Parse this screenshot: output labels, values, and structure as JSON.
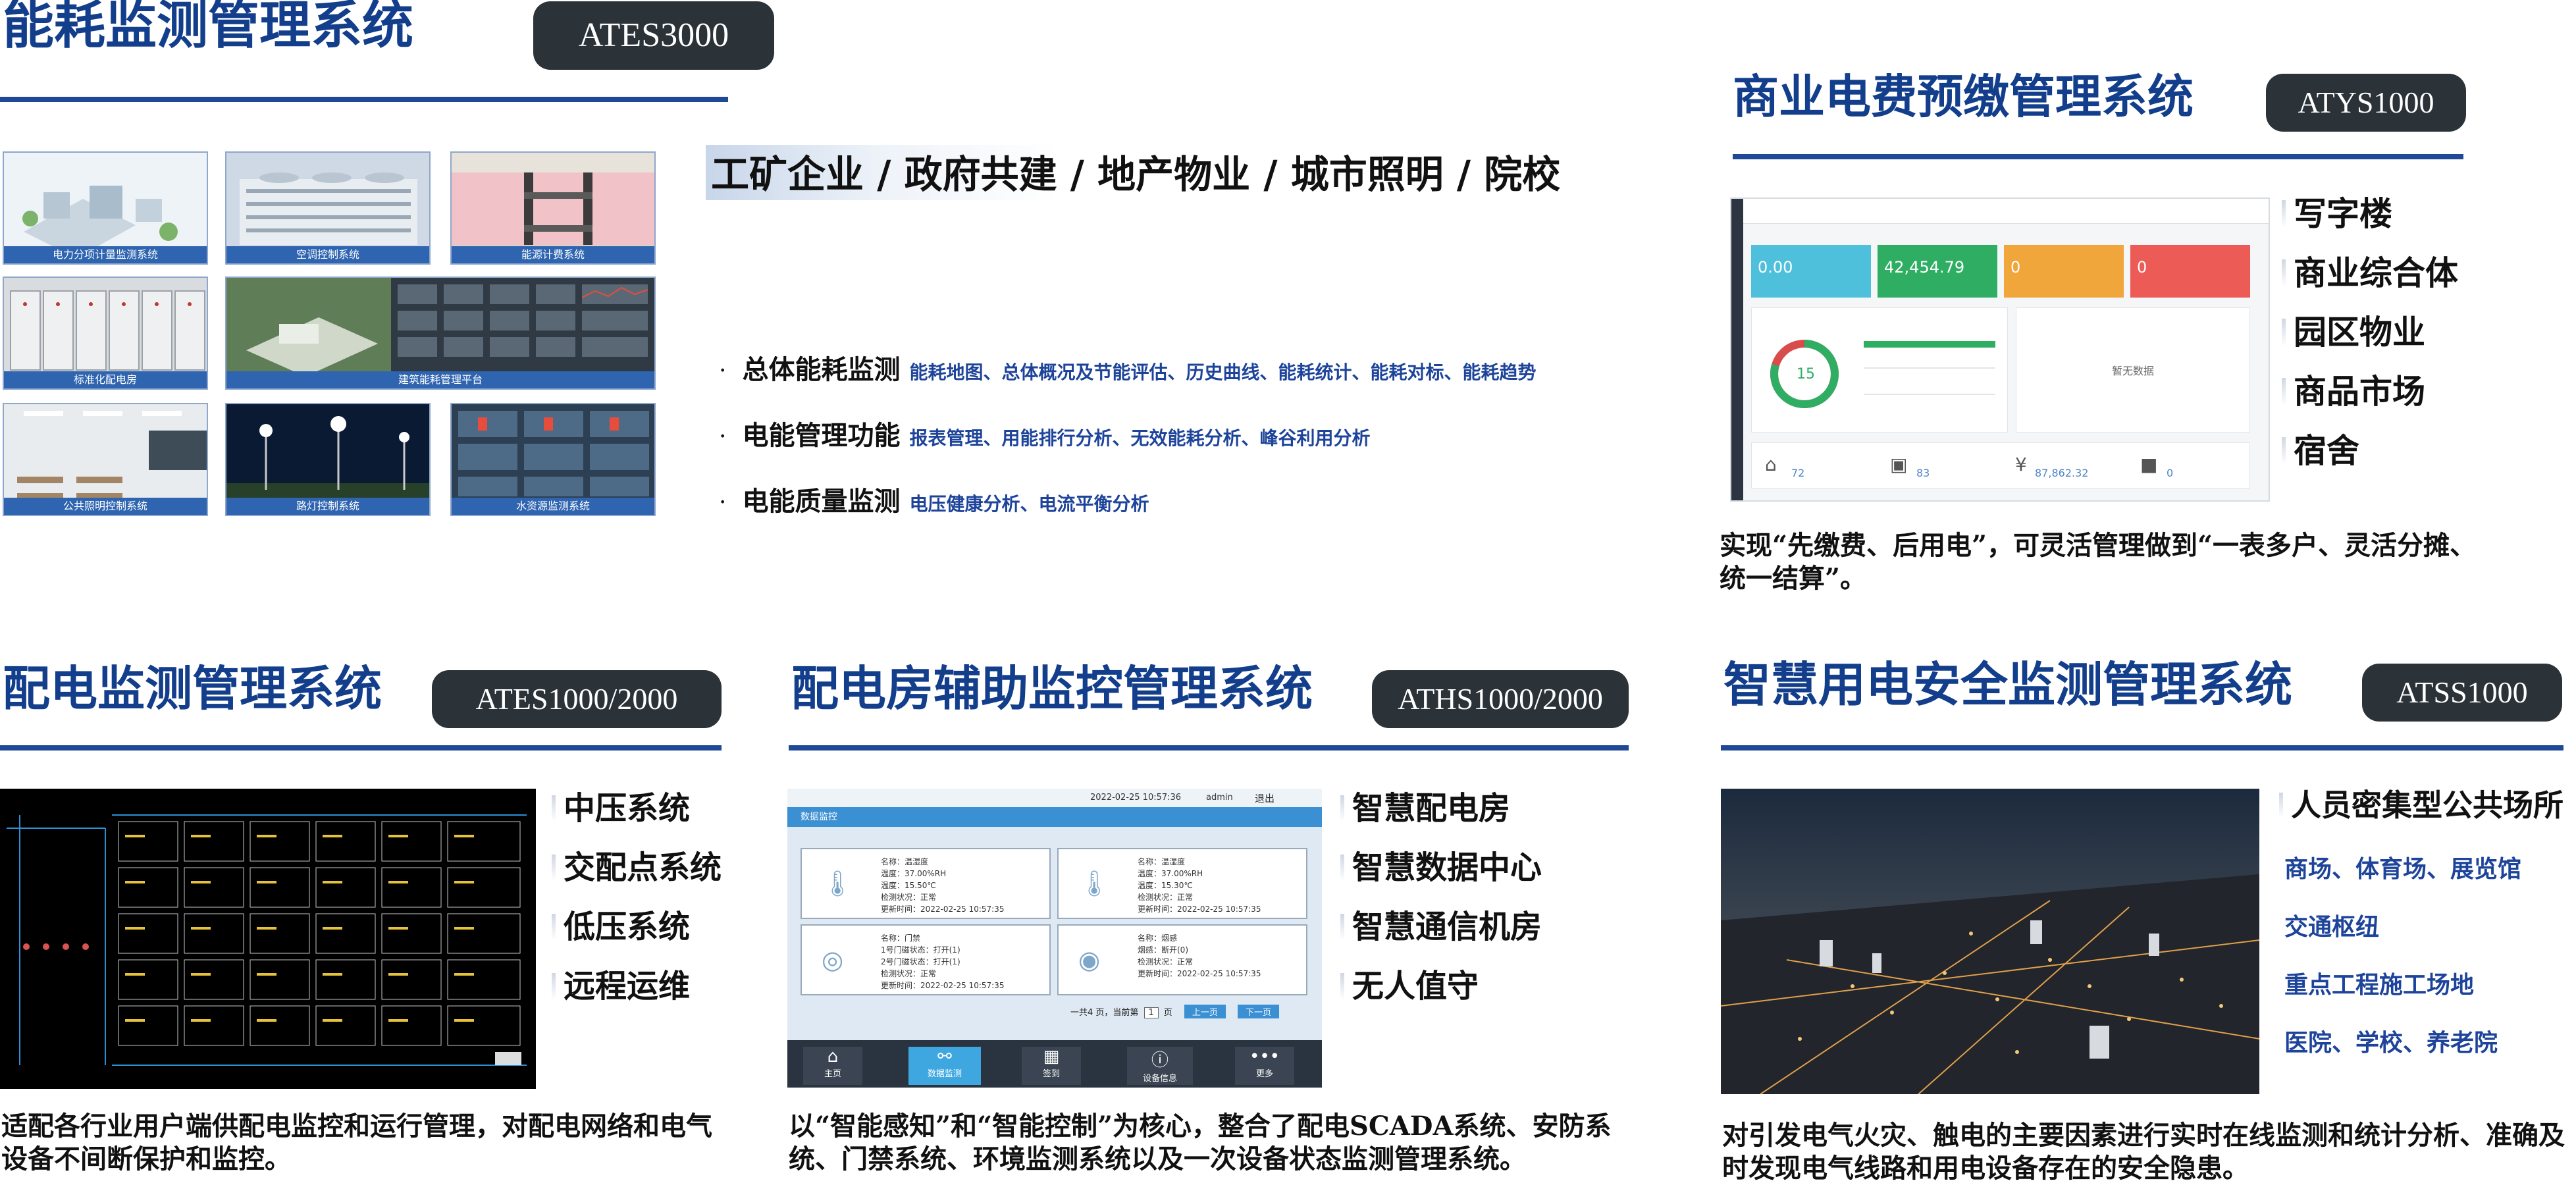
{
  "colors": {
    "title_blue": "#133e8c",
    "badge_dark": "#2b3238",
    "rule_blue": "#1f4896",
    "accent_blue": "#1d449a"
  },
  "ates3000": {
    "title": "能耗监测管理系统",
    "badge": "ATES3000",
    "industries": "工矿企业 / 政府共建 / 地产物业 / 城市照明 / 院校",
    "thumbs": [
      "电力分项计量监测系统",
      "空调控制系统",
      "能源计费系统",
      "标准化配电房",
      "建筑能耗管理平台",
      "",
      "公共照明控制系统",
      "路灯控制系统",
      "水资源监测系统"
    ],
    "features": [
      {
        "key": "总体能耗监测",
        "value": "能耗地图、总体概况及节能评估、历史曲线、能耗统计、能耗对标、能耗趋势"
      },
      {
        "key": "电能管理功能",
        "value": "报表管理、用能排行分析、无效能耗分析、峰谷利用分析"
      },
      {
        "key": "电能质量监测",
        "value": "电压健康分析、电流平衡分析"
      }
    ]
  },
  "atys1000": {
    "title": "商业电费预缴管理系统",
    "badge": "ATYS1000",
    "items": [
      "写字楼",
      "商业综合体",
      "园区物业",
      "商品市场",
      "宿舍"
    ],
    "desc": "实现“先缴费、后用电”，可灵活管理做到“一表多户、灵活分摊、统一结算”。",
    "screen": {
      "cards": [
        "0.00",
        "42,454.79",
        "0",
        "0"
      ],
      "gauge": "15",
      "empty": "暂无数据",
      "stats": [
        "72",
        "83",
        "87,862.32",
        "0"
      ]
    }
  },
  "ates1000": {
    "title": "配电监测管理系统",
    "badge": "ATES1000/2000",
    "items": [
      "中压系统",
      "交配点系统",
      "低压系统",
      "远程运维"
    ],
    "desc": "适配各行业用户端供配电监控和运行管理，对配电网络和电气设备不间断保护和监控。"
  },
  "aths1000": {
    "title": "配电房辅助监控管理系统",
    "badge": "ATHS1000/2000",
    "items": [
      "智慧配电房",
      "智慧数据中心",
      "智慧通信机房",
      "无人值守"
    ],
    "desc": "以“智能感知”和“智能控制”为核心，整合了配电SCADA系统、安防系统、门禁系统、环境监测系统以及一次设备状态监测管理系统。",
    "screen": {
      "time": "2022-02-25 10:57:36",
      "user": "admin",
      "logout": "退出",
      "header": "数据监控",
      "panels": [
        [
          "名称：温湿度",
          "温度：37.00%RH",
          "温度：15.50℃",
          "检测状况：正常",
          "更新时间：2022-02-25 10:57:35"
        ],
        [
          "名称：温湿度",
          "温度：37.00%RH",
          "温度：15.30℃",
          "检测状况：正常",
          "更新时间：2022-02-25 10:57:35"
        ],
        [
          "名称：门禁",
          "1号门磁状态：打开(1)",
          "2号门磁状态：打开(1)",
          "检测状况：正常",
          "更新时间：2022-02-25 10:57:35"
        ],
        [
          "名称：烟感",
          "烟感：断开(0)",
          "检测状况：正常",
          "更新时间：2022-02-25 10:57:35"
        ]
      ],
      "pager": "一共4 页，当前第",
      "page": "1",
      "page_unit": "页",
      "prev": "上一页",
      "next": "下一页",
      "nav": [
        "主页",
        "数据监测",
        "签到",
        "设备信息",
        "更多"
      ]
    }
  },
  "atss1000": {
    "title": "智慧用电安全监测管理系统",
    "badge": "ATSS1000",
    "heading": "人员密集型公共场所",
    "items": [
      "商场、体育场、展览馆",
      "交通枢纽",
      "重点工程施工场地",
      "医院、学校、养老院"
    ],
    "desc": "对引发电气火灾、触电的主要因素进行实时在线监测和统计分析、准确及时发现电气线路和用电设备存在的安全隐患。"
  }
}
